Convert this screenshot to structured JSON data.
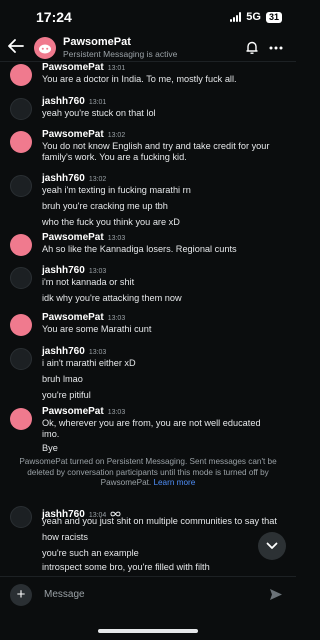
{
  "status_bar": {
    "time": "17:24",
    "network": "5G",
    "battery": "31"
  },
  "header": {
    "title": "PawsomePat",
    "subtitle": "Persistent Messaging is active"
  },
  "messages": [
    {
      "author": "PawsomePat",
      "time": "13:01",
      "lines": [
        "You are a doctor in India. To me, mostly fuck all."
      ]
    },
    {
      "author": "jashh760",
      "time": "13:01",
      "lines": [
        "yeah you're stuck on that lol"
      ]
    },
    {
      "author": "PawsomePat",
      "time": "13:02",
      "lines": [
        "You do not know English and try and take credit for your",
        "family's work. You are a fucking kid."
      ]
    },
    {
      "author": "jashh760",
      "time": "13:02",
      "lines": [
        "yeah i'm texting in fucking marathi rn",
        "bruh you're cracking me up tbh",
        "who the fuck you think you are xD"
      ]
    },
    {
      "author": "PawsomePat",
      "time": "13:03",
      "lines": [
        "Ah so like the Kannadiga losers. Regional cunts"
      ]
    },
    {
      "author": "jashh760",
      "time": "13:03",
      "lines": [
        "i'm not kannada or shit",
        "idk why you're attacking them now"
      ]
    },
    {
      "author": "PawsomePat",
      "time": "13:03",
      "lines": [
        "You are some Marathi cunt"
      ]
    },
    {
      "author": "jashh760",
      "time": "13:03",
      "lines": [
        "i ain't marathi either xD",
        "bruh lmao",
        "you're pitiful"
      ]
    },
    {
      "author": "PawsomePat",
      "time": "13:03",
      "lines": [
        "Ok, wherever you are from, you are not well educated",
        "imo.",
        "Bye"
      ]
    },
    {
      "author": "jashh760",
      "time": "13:04",
      "lines": [
        "yeah and you just shit on multiple communities to say that",
        "how racists",
        "you're such an example",
        "introspect some bro, you're filled with filth"
      ]
    }
  ],
  "system_note": {
    "text": "PawsomePat turned on Persistent Messaging. Sent messages can't be deleted by conversation participants until this mode is turned off by PawsomePat.",
    "link": "Learn more"
  },
  "composer": {
    "placeholder": "Message"
  },
  "colors": {
    "accent_link": "#4f8ef7",
    "avatar_pink": "#f07a8e",
    "background": "#0b0d0e"
  }
}
